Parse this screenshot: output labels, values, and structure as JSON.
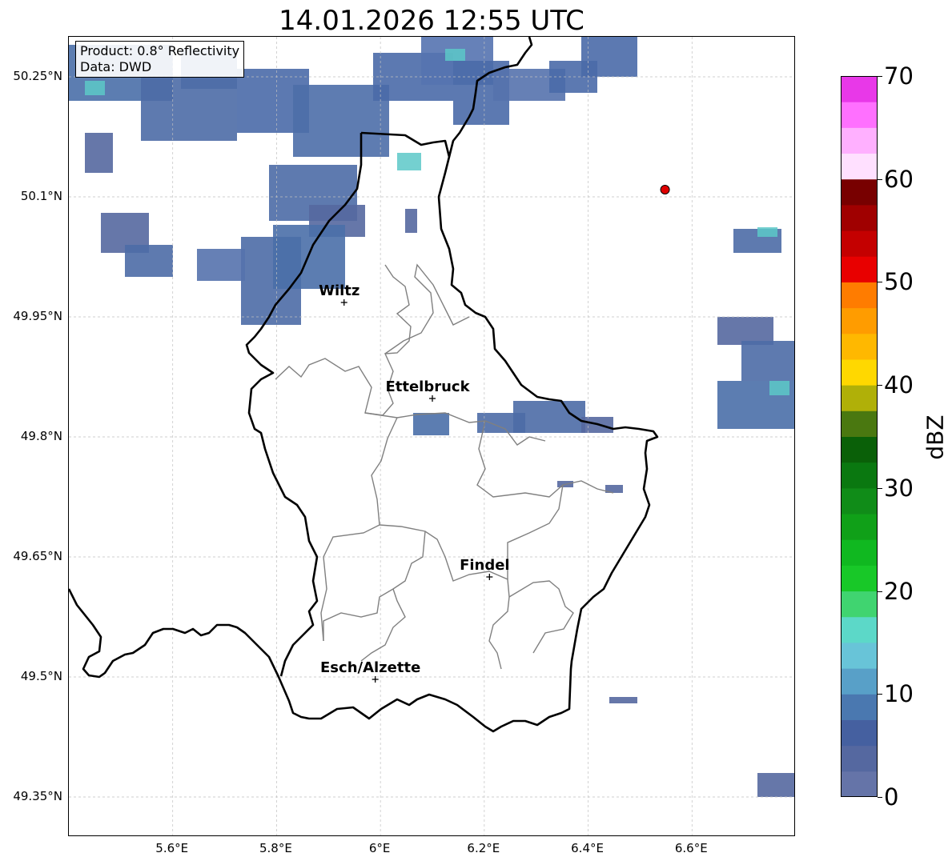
{
  "title": "14.01.2026 12:55 UTC",
  "info": {
    "line1": "Product: 0.8° Reflectivity",
    "line2": "Data: DWD"
  },
  "map": {
    "lat_range": [
      49.3,
      50.3
    ],
    "lon_range": [
      5.4,
      6.8
    ],
    "lat_ticks": [
      50.25,
      50.1,
      49.95,
      49.8,
      49.65,
      49.5,
      49.35
    ],
    "lat_tick_labels": [
      "50.25°N",
      "50.1°N",
      "49.95°N",
      "49.8°N",
      "49.65°N",
      "49.5°N",
      "49.35°N"
    ],
    "lon_ticks": [
      5.6,
      5.8,
      6.0,
      6.2,
      6.4,
      6.6
    ],
    "lon_tick_labels": [
      "5.6°E",
      "5.8°E",
      "6°E",
      "6.2°E",
      "6.4°E",
      "6.6°E"
    ],
    "grid": true,
    "cities": [
      {
        "name": "Wiltz",
        "lon": 5.93,
        "lat": 49.968
      },
      {
        "name": "Ettelbruck",
        "lon": 6.1,
        "lat": 49.848
      },
      {
        "name": "Findel",
        "lon": 6.21,
        "lat": 49.625
      },
      {
        "name": "Esch/Alzette",
        "lon": 5.99,
        "lat": 49.497
      }
    ],
    "radar_site": {
      "lon": 6.548,
      "lat": 50.109,
      "color": "#e00000"
    },
    "colors": {
      "country_border": "#000000",
      "district_border": "#808080",
      "grid": "#c0c0c0"
    }
  },
  "colorbar": {
    "label": "dBZ",
    "ticks": [
      "0",
      "10",
      "20",
      "30",
      "40",
      "50",
      "60",
      "70"
    ],
    "vmin": 0,
    "vmax": 70,
    "step": 2.5,
    "colors": [
      "#6574a8",
      "#5568a0",
      "#4560a0",
      "#4a78b0",
      "#58a0c8",
      "#68c4d8",
      "#5cd8c8",
      "#40d470",
      "#18c828",
      "#10b820",
      "#10a018",
      "#108c18",
      "#0a7810",
      "#0a6008",
      "#4a7810",
      "#b0b008",
      "#ffd800",
      "#ffb800",
      "#ff9c00",
      "#ff7c00",
      "#e80000",
      "#c40000",
      "#a00000",
      "#780000",
      "#ffe0ff",
      "#ffb0ff",
      "#ff70ff",
      "#e838e8"
    ]
  }
}
